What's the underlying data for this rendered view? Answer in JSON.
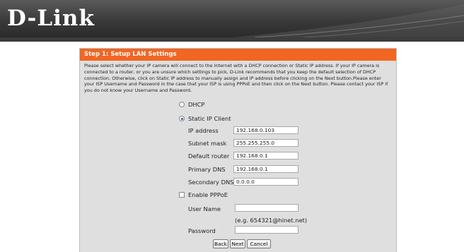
{
  "header": {
    "logo": "D-Link"
  },
  "panel": {
    "title": "Step 1: Setup LAN Settings",
    "intro": "Please select whether your IP camera will connect to the Internet with a DHCP connection or Static IP address. If your IP camera is connected to a router, or you are unsure which settings to pick, D-Link recommends that you keep the default selection of DHCP connection. Otherwise, click on Static IP address to manually assign and IP address before clicking on the Next button.Please enter your ISP Username and Password in the case that your ISP is using PPPoE and then click on the Next button. Please contact your ISP if you do not know your Username and Password."
  },
  "connection": {
    "dhcp_label": "DHCP",
    "static_label": "Static IP Client",
    "selected": "static"
  },
  "static": {
    "ip_label": "IP address",
    "ip_value": "192.168.0.103",
    "subnet_label": "Subnet mask",
    "subnet_value": "255.255.255.0",
    "router_label": "Default router",
    "router_value": "192.168.0.1",
    "dns1_label": "Primary DNS",
    "dns1_value": "192.168.0.1",
    "dns2_label": "Secondary DNS",
    "dns2_value": "0.0.0.0"
  },
  "pppoe": {
    "enable_label": "Enable PPPoE",
    "enabled": false,
    "username_label": "User Name",
    "username_value": "",
    "username_hint": "(e.g. 654321@hinet.net)",
    "password_label": "Password",
    "password_value": ""
  },
  "buttons": {
    "back": "Back",
    "next": "Next",
    "cancel": "Cancel"
  }
}
